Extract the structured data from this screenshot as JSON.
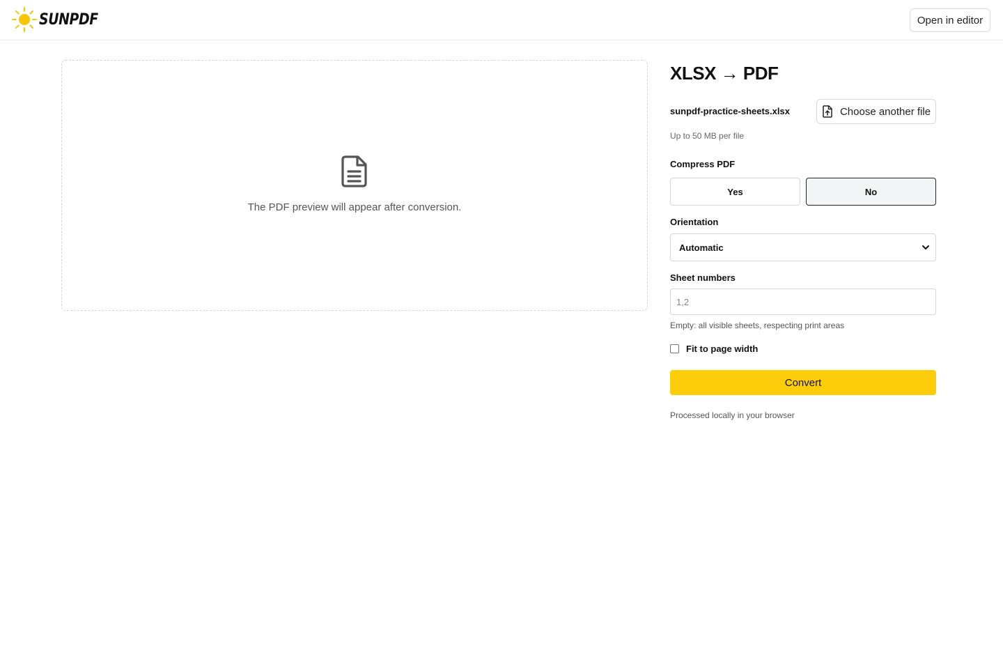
{
  "header": {
    "brand": "SUNPDF",
    "open_editor_label": "Open in editor"
  },
  "preview": {
    "message": "The PDF preview will appear after conversion."
  },
  "panel": {
    "title": "XLSX → PDF",
    "filename": "sunpdf-practice-sheets.xlsx",
    "choose_label": "Choose another file",
    "size_hint": "Up to 50 MB per file",
    "compress": {
      "label": "Compress PDF",
      "yes_label": "Yes",
      "no_label": "No",
      "selected": "No"
    },
    "orientation": {
      "label": "Orientation",
      "value": "Automatic"
    },
    "sheets": {
      "label": "Sheet numbers",
      "placeholder": "1,2",
      "hint": "Empty: all visible sheets, respecting print areas"
    },
    "fit": {
      "label": "Fit to page width",
      "checked": false
    },
    "convert_label": "Convert",
    "local_note": "Processed locally in your browser"
  },
  "colors": {
    "accent": "#fdcc0a",
    "sun": "#f7c600"
  }
}
